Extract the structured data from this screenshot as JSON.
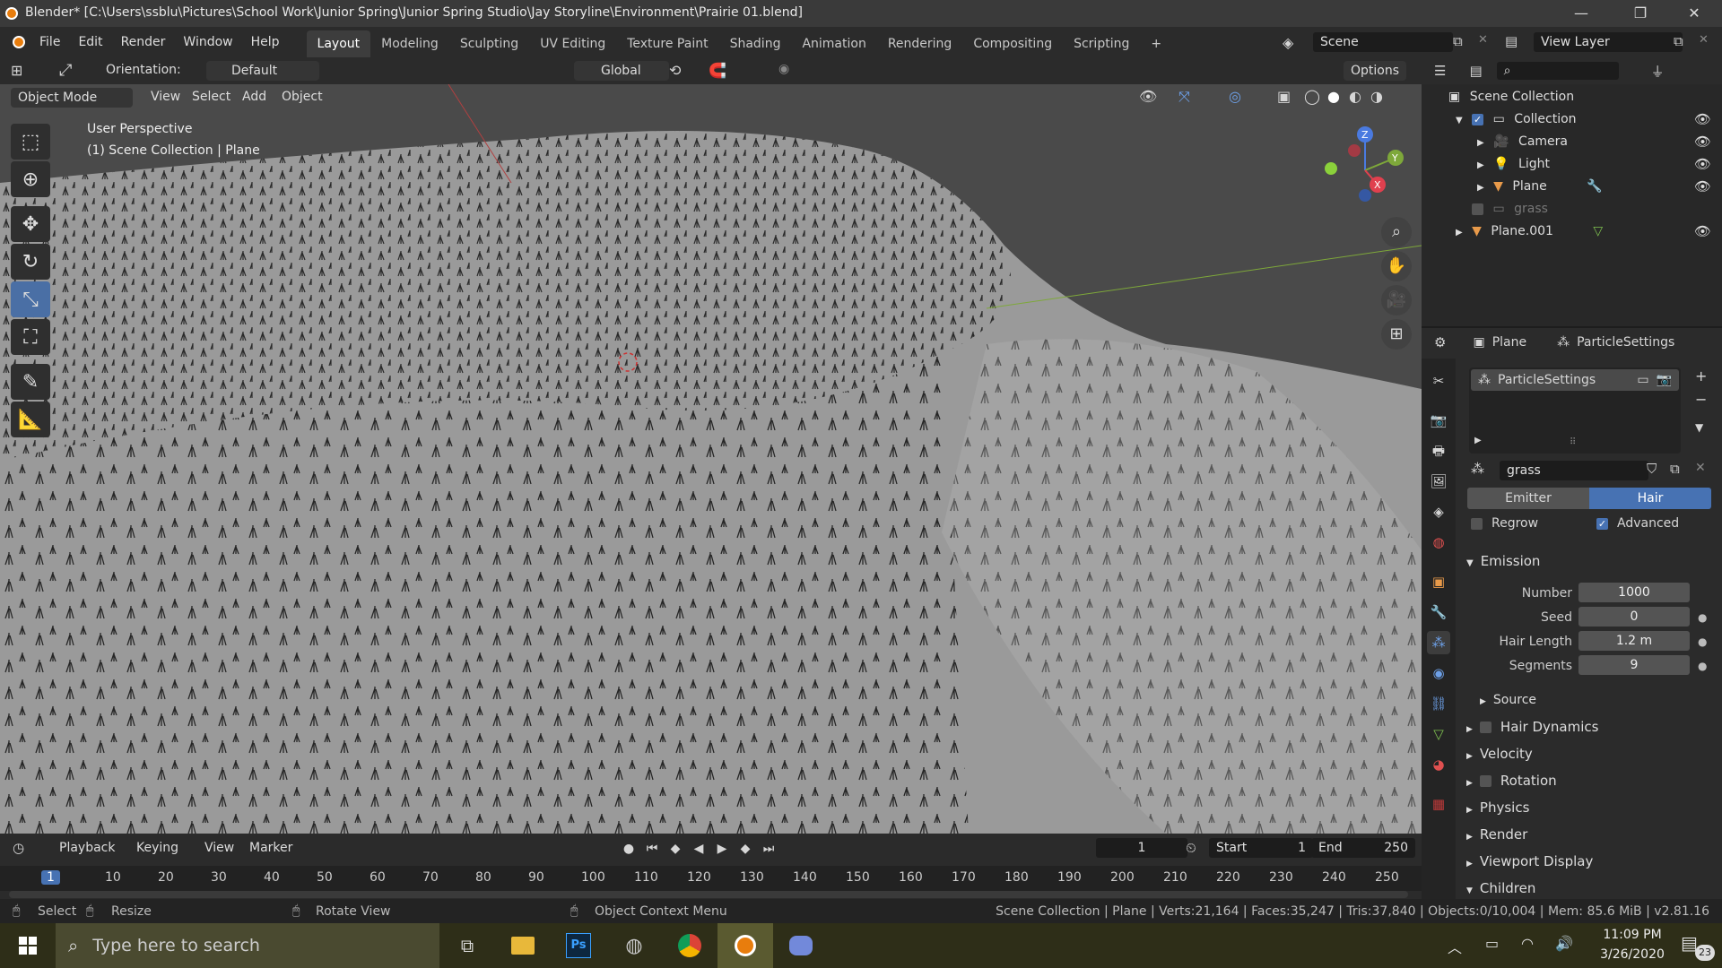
{
  "window": {
    "title": "Blender* [C:\\Users\\ssblu\\Pictures\\School Work\\Junior Spring\\Junior Spring Studio\\Jay Storyline\\Environment\\Prairie 01.blend]",
    "minimize": "—",
    "maximize": "❐",
    "close": "✕"
  },
  "menubar": {
    "menus": [
      "File",
      "Edit",
      "Render",
      "Window",
      "Help"
    ],
    "workspaces": [
      "Layout",
      "Modeling",
      "Sculpting",
      "UV Editing",
      "Texture Paint",
      "Shading",
      "Animation",
      "Rendering",
      "Compositing",
      "Scripting"
    ],
    "add_workspace": "+",
    "scene": "Scene",
    "view_layer": "View Layer"
  },
  "viewport_header": {
    "orientation_label": "Orientation:",
    "orientation_value": "Default",
    "transform": "Global",
    "options": "Options",
    "mode": "Object Mode",
    "menus": [
      "View",
      "Select",
      "Add",
      "Object"
    ]
  },
  "viewport": {
    "perspective": "User Perspective",
    "collection_info": "(1) Scene Collection | Plane",
    "gizmo": {
      "x": "X",
      "y": "Y",
      "z": "Z"
    }
  },
  "outliner": {
    "items": [
      {
        "name": "Scene Collection",
        "icon": "scene-collection-icon"
      },
      {
        "name": "Collection",
        "icon": "collection-icon"
      },
      {
        "name": "Camera",
        "icon": "camera-icon"
      },
      {
        "name": "Light",
        "icon": "light-icon"
      },
      {
        "name": "Plane",
        "icon": "mesh-icon"
      },
      {
        "name": "grass",
        "icon": "collection-icon"
      },
      {
        "name": "Plane.001",
        "icon": "mesh-icon"
      }
    ]
  },
  "properties": {
    "breadcrumb_object": "Plane",
    "breadcrumb_settings": "ParticleSettings",
    "slot_name": "ParticleSettings",
    "particle_name": "grass",
    "type_options": [
      "Emitter",
      "Hair"
    ],
    "type_selected": "Hair",
    "regrow_label": "Regrow",
    "advanced_label": "Advanced",
    "emission_title": "Emission",
    "emission": [
      {
        "label": "Number",
        "value": "1000"
      },
      {
        "label": "Seed",
        "value": "0"
      },
      {
        "label": "Hair Length",
        "value": "1.2 m"
      },
      {
        "label": "Segments",
        "value": "9"
      }
    ],
    "source_label": "Source",
    "sections": [
      "Hair Dynamics",
      "Velocity",
      "Rotation",
      "Physics",
      "Render",
      "Viewport Display",
      "Children"
    ]
  },
  "timeline": {
    "menus": [
      "Playback",
      "Keying",
      "View",
      "Marker"
    ],
    "current_frame": "1",
    "start_label": "Start",
    "start": "1",
    "end_label": "End",
    "end": "250",
    "ticks": [
      "1",
      "10",
      "20",
      "30",
      "40",
      "50",
      "60",
      "70",
      "80",
      "90",
      "100",
      "110",
      "120",
      "130",
      "140",
      "150",
      "160",
      "170",
      "180",
      "190",
      "200",
      "210",
      "220",
      "230",
      "240",
      "250"
    ]
  },
  "statusbar": {
    "select": "Select",
    "resize": "Resize",
    "rotate": "Rotate View",
    "context_menu": "Object Context Menu",
    "stats": "Scene Collection | Plane | Verts:21,164 | Faces:35,247 | Tris:37,840 | Objects:0/10,004 | Mem: 85.6 MiB | v2.81.16"
  },
  "taskbar": {
    "search_placeholder": "Type here to search",
    "time": "11:09 PM",
    "date": "3/26/2020",
    "notifications": "23",
    "apps": [
      "task-view",
      "file-explorer",
      "photoshop",
      "chrome-alt",
      "chrome",
      "blender",
      "discord"
    ]
  },
  "colors": {
    "accent": "#4772b3",
    "blender_orange": "#e87d0d",
    "active_tool": "#4a6fa5"
  }
}
